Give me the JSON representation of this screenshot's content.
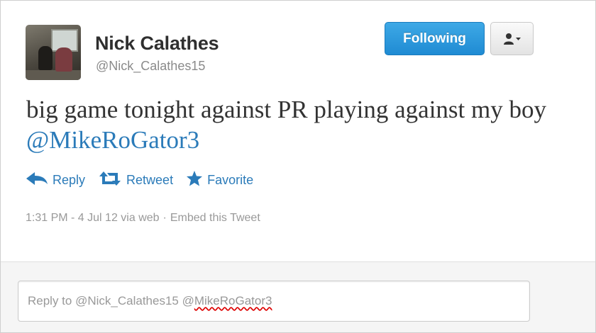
{
  "tweet": {
    "author_name": "Nick Calathes",
    "author_handle": "@Nick_Calathes15",
    "text_part1": "big game tonight against PR playing against my boy ",
    "mention": "@MikeRoGator3"
  },
  "header": {
    "follow_label": "Following",
    "follow_color": "#2b90d9"
  },
  "actions": {
    "reply_label": "Reply",
    "retweet_label": "Retweet",
    "favorite_label": "Favorite",
    "accent_color": "#2b7bb9"
  },
  "meta": {
    "timestamp": "1:31 PM - 4 Jul 12 via web",
    "separator": "·",
    "embed_label": "Embed this Tweet"
  },
  "reply": {
    "prefix": "Reply to @Nick_Calathes15 @",
    "misspelled_part": "MikeRoGator3"
  },
  "icons": [
    "user-dropdown-icon",
    "reply-icon",
    "retweet-icon",
    "star-icon"
  ]
}
